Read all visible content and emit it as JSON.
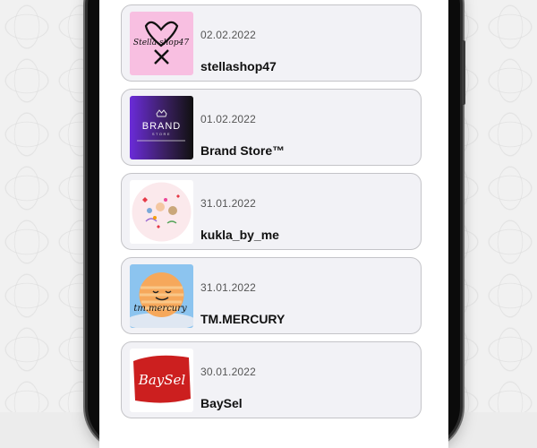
{
  "shops": [
    {
      "date": "02.02.2022",
      "name": "stellashop47",
      "logo_text": "Stella shop47",
      "logo": "stella-logo-icon",
      "bg": "#f8bfe1"
    },
    {
      "date": "01.02.2022",
      "name": "Brand Store™",
      "logo_text": "BRAND",
      "logo_sub": "STORE",
      "logo": "brand-store-logo-icon",
      "bg": "#7b2fd6"
    },
    {
      "date": "31.01.2022",
      "name": "kukla_by_me",
      "logo": "kukla-logo-icon",
      "bg": "#fbe9ec"
    },
    {
      "date": "31.01.2022",
      "name": "TM.MERCURY",
      "logo_text": "tm.mercury",
      "logo": "mercury-planet-logo-icon",
      "bg": "#8cc4ef"
    },
    {
      "date": "30.01.2022",
      "name": "BaySel",
      "logo_text": "BaySel",
      "logo": "baysel-logo-icon",
      "bg": "#cc1f1f"
    }
  ]
}
